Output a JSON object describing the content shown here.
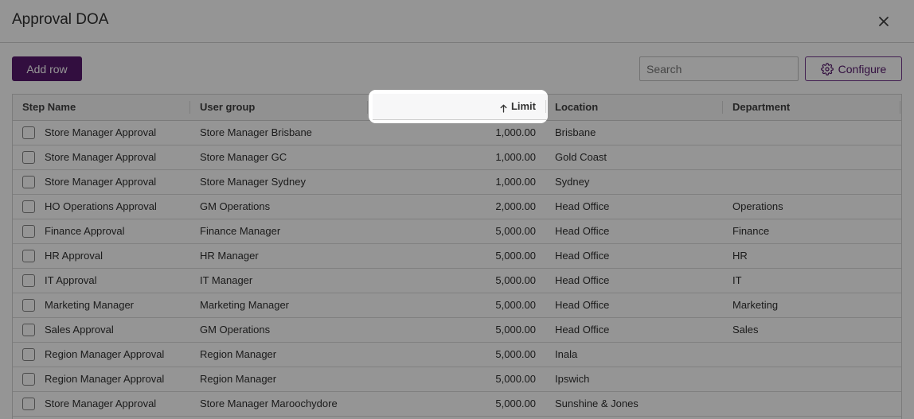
{
  "dialog": {
    "title": "Approval DOA",
    "close_icon": "close-icon"
  },
  "toolbar": {
    "add_row_label": "Add row",
    "search_placeholder": "Search",
    "configure_label": "Configure",
    "configure_icon": "gear-icon"
  },
  "table": {
    "columns": [
      "Step Name",
      "User group",
      "Limit",
      "Location",
      "Department"
    ],
    "sort": {
      "column": "Limit",
      "direction": "ascending",
      "icon": "arrow-up-icon"
    },
    "rows": [
      {
        "step": "Store Manager Approval",
        "group": "Store Manager Brisbane",
        "limit": "1,000.00",
        "location": "Brisbane",
        "department": ""
      },
      {
        "step": "Store Manager Approval",
        "group": "Store Manager GC",
        "limit": "1,000.00",
        "location": "Gold Coast",
        "department": ""
      },
      {
        "step": "Store Manager Approval",
        "group": "Store Manager Sydney",
        "limit": "1,000.00",
        "location": "Sydney",
        "department": ""
      },
      {
        "step": "HO Operations Approval",
        "group": "GM Operations",
        "limit": "2,000.00",
        "location": "Head Office",
        "department": "Operations"
      },
      {
        "step": "Finance Approval",
        "group": "Finance Manager",
        "limit": "5,000.00",
        "location": "Head Office",
        "department": "Finance"
      },
      {
        "step": "HR Approval",
        "group": "HR Manager",
        "limit": "5,000.00",
        "location": "Head Office",
        "department": "HR"
      },
      {
        "step": "IT Approval",
        "group": "IT Manager",
        "limit": "5,000.00",
        "location": "Head Office",
        "department": "IT"
      },
      {
        "step": "Marketing Manager",
        "group": "Marketing Manager",
        "limit": "5,000.00",
        "location": "Head Office",
        "department": "Marketing"
      },
      {
        "step": "Sales Approval",
        "group": "GM Operations",
        "limit": "5,000.00",
        "location": "Head Office",
        "department": "Sales"
      },
      {
        "step": "Region Manager Approval",
        "group": "Region Manager",
        "limit": "5,000.00",
        "location": "Inala",
        "department": ""
      },
      {
        "step": "Region Manager Approval",
        "group": "Region Manager",
        "limit": "5,000.00",
        "location": "Ipswich",
        "department": ""
      },
      {
        "step": "Store Manager Approval",
        "group": "Store Manager Maroochydore",
        "limit": "5,000.00",
        "location": "Sunshine & Jones",
        "department": ""
      }
    ]
  },
  "colors": {
    "accent": "#4b0a63",
    "overlay": "rgba(20,20,20,0.45)"
  }
}
